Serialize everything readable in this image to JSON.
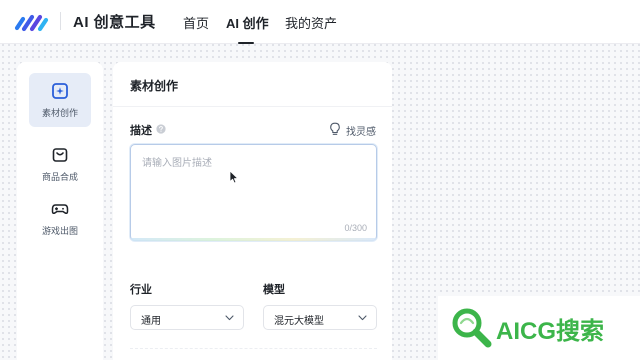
{
  "header": {
    "brand": "AI 创意工具",
    "nav": [
      {
        "label": "首页",
        "active": false
      },
      {
        "label": "AI 创作",
        "active": true
      },
      {
        "label": "我的资产",
        "active": false
      }
    ]
  },
  "sidebar": {
    "items": [
      {
        "label": "素材创作",
        "icon": "plus-square-icon",
        "active": true
      },
      {
        "label": "商品合成",
        "icon": "shopping-bag-icon",
        "active": false
      },
      {
        "label": "游戏出图",
        "icon": "gamepad-icon",
        "active": false
      }
    ]
  },
  "panel": {
    "title": "素材创作",
    "description": {
      "label": "描述",
      "inspiration_label": "找灵感",
      "placeholder": "请输入图片描述",
      "counter": "0/300"
    },
    "industry": {
      "label": "行业",
      "value": "通用"
    },
    "model": {
      "label": "模型",
      "value": "混元大模型"
    }
  },
  "watermark": {
    "text": "AICG搜索"
  },
  "colors": {
    "accent": "#2b5fd9",
    "active_bg": "#e6ecf7",
    "watermark": "#3cb54a"
  }
}
